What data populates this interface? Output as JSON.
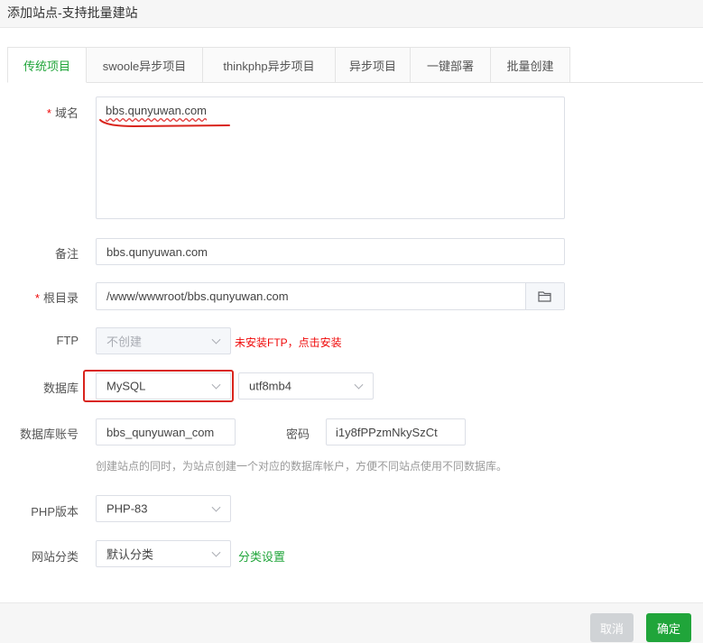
{
  "dialog": {
    "title": "添加站点-支持批量建站"
  },
  "tabs": [
    {
      "label": "传统项目"
    },
    {
      "label": "swoole异步项目"
    },
    {
      "label": "thinkphp异步项目"
    },
    {
      "label": "异步项目"
    },
    {
      "label": "一键部署"
    },
    {
      "label": "批量创建"
    }
  ],
  "form": {
    "domain": {
      "label": "域名",
      "value": "bbs.qunyuwan.com"
    },
    "remark": {
      "label": "备注",
      "value": "bbs.qunyuwan.com"
    },
    "root": {
      "label": "根目录",
      "value": "/www/wwwroot/bbs.qunyuwan.com"
    },
    "ftp": {
      "label": "FTP",
      "value": "不创建",
      "warning": "未安装FTP，点击安装"
    },
    "database": {
      "label": "数据库",
      "type": "MySQL",
      "charset": "utf8mb4"
    },
    "db_account": {
      "label": "数据库账号",
      "value": "bbs_qunyuwan_com",
      "password_label": "密码",
      "password": "i1y8fPPzmNkySzCt",
      "hint": "创建站点的同时，为站点创建一个对应的数据库帐户，方便不同站点使用不同数据库。"
    },
    "php": {
      "label": "PHP版本",
      "value": "PHP-83"
    },
    "category": {
      "label": "网站分类",
      "value": "默认分类",
      "link": "分类设置"
    }
  },
  "footer": {
    "cancel": "取消",
    "confirm": "确定"
  },
  "colors": {
    "accent": "#20a53a",
    "danger": "#ef0808",
    "annotation": "#d9241c"
  }
}
